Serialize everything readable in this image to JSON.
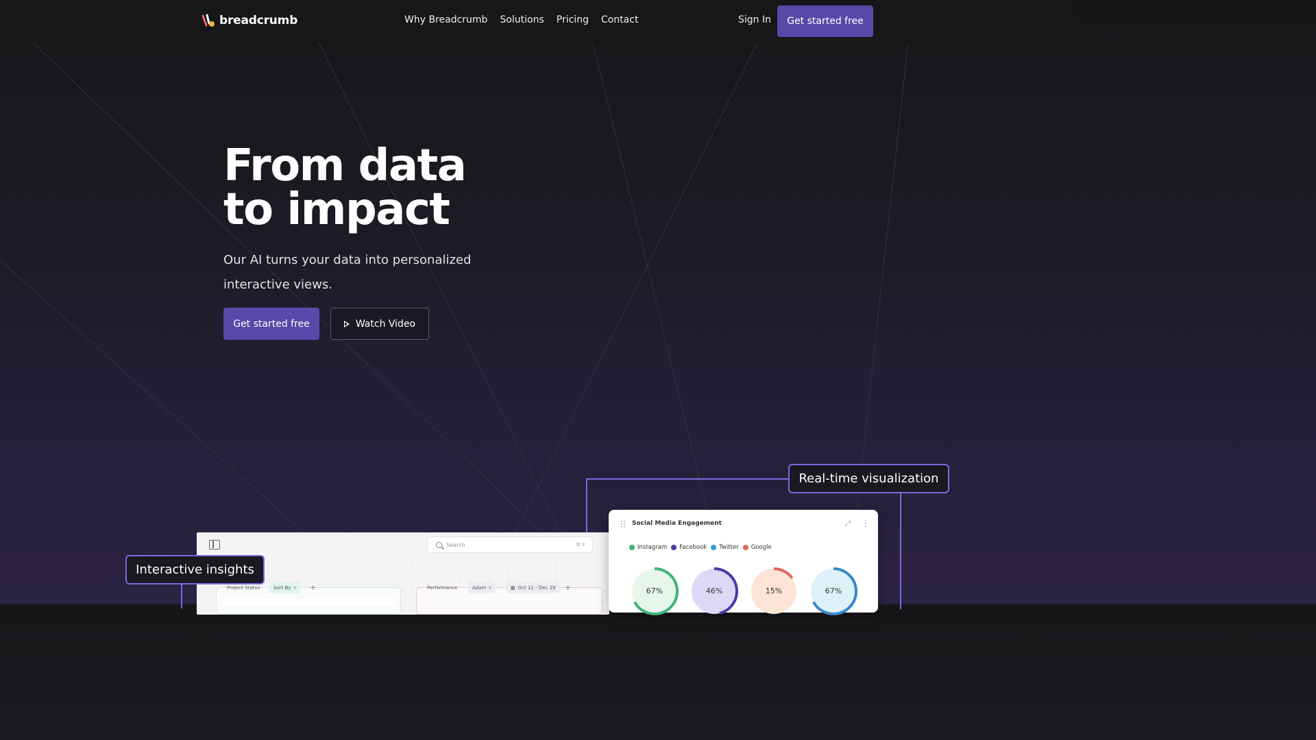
{
  "nav": {
    "brand": "breadcrumb",
    "links": [
      "Why Breadcrumb",
      "Solutions",
      "Pricing",
      "Contact"
    ],
    "sign_in": "Sign In",
    "cta": "Get started free"
  },
  "hero": {
    "title_line1": "From data",
    "title_line2": "to impact",
    "subtitle": "Our AI turns your data into personalized interactive views.",
    "primary_button": "Get started free",
    "secondary_button": "Watch Video"
  },
  "dashboard": {
    "search_placeholder": "Search",
    "search_shortcut": "⌘ K",
    "left_panel": {
      "label": "Project Status",
      "sort": "Sort By"
    },
    "right_panel": {
      "label": "Performance",
      "user": "Adam",
      "date_range": "Oct 11 - Dec 29"
    }
  },
  "engagement_card": {
    "title": "Social Media Engagement",
    "legend": [
      {
        "name": "Instagram",
        "color": "#3fb37a"
      },
      {
        "name": "Facebook",
        "color": "#4a3aa6"
      },
      {
        "name": "Twitter",
        "color": "#3a9bd0"
      },
      {
        "name": "Google",
        "color": "#e0675e"
      }
    ],
    "donuts": [
      {
        "value": "67%",
        "fraction": 0.67,
        "color": "#3fb37a",
        "fill": "#e6f6ea"
      },
      {
        "value": "46%",
        "fraction": 0.46,
        "color": "#4a3aa6",
        "fill": "#dcd8f6"
      },
      {
        "value": "15%",
        "fraction": 0.15,
        "color": "#e0675e",
        "fill": "#fde4d6"
      },
      {
        "value": "67%",
        "fraction": 0.67,
        "color": "#3a87c8",
        "fill": "#dcf1f8"
      }
    ]
  },
  "callouts": {
    "right": "Real-time visualization",
    "left": "Interactive insights"
  },
  "colors": {
    "accent": "#5a48a8",
    "callout_border": "#7c6ae0"
  }
}
